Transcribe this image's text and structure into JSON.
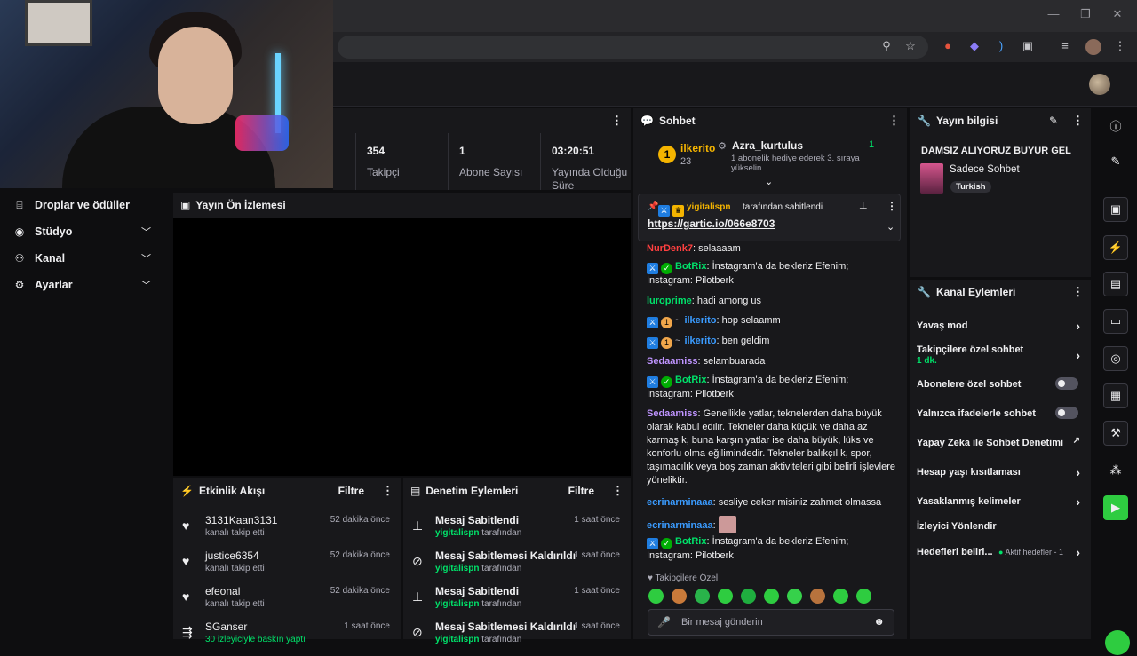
{
  "browser": {
    "window_min": "—",
    "window_max": "❐",
    "window_close": "✕"
  },
  "stats": {
    "followers_value": "354",
    "followers_label": "Takipçi",
    "subs_value": "1",
    "subs_label": "Abone Sayısı",
    "uptime_value": "03:20:51",
    "uptime_label": "Yayında Olduğu Süre"
  },
  "nav": {
    "items": [
      {
        "label": "Droplar ve ödüller",
        "icon": "gift-icon"
      },
      {
        "label": "Stüdyo",
        "icon": "studio-icon"
      },
      {
        "label": "Kanal",
        "icon": "channel-icon"
      },
      {
        "label": "Ayarlar",
        "icon": "gear-icon"
      }
    ]
  },
  "preview": {
    "title": "Yayın Ön İzlemesi"
  },
  "activity": {
    "title": "Etkinlik Akışı",
    "filter": "Filtre",
    "rows": [
      {
        "name": "3131Kaan3131",
        "sub": "kanalı takip etti",
        "time": "52 dakika önce"
      },
      {
        "name": "justice6354",
        "sub": "kanalı takip etti",
        "time": "52 dakika önce"
      },
      {
        "name": "efeonal",
        "sub": "kanalı takip etti",
        "time": "52 dakika önce"
      },
      {
        "name": "SGanser",
        "sub": "30 izleyiciyle baskın yaptı",
        "time": "1 saat önce"
      }
    ]
  },
  "modactions": {
    "title": "Denetim Eylemleri",
    "filter": "Filtre",
    "rows": [
      {
        "name": "Mesaj Sabitlendi",
        "by": "yigitalispn",
        "suffix": " tarafından",
        "time": "1 saat önce"
      },
      {
        "name": "Mesaj Sabitlemesi Kaldırıldı",
        "by": "yigitalispn",
        "suffix": " tarafından",
        "time": "1 saat önce"
      },
      {
        "name": "Mesaj Sabitlendi",
        "by": "yigitalispn",
        "suffix": " tarafından",
        "time": "1 saat önce"
      },
      {
        "name": "Mesaj Sabitlemesi Kaldırıldı",
        "by": "yigitalispn",
        "suffix": " tarafından",
        "time": "1 saat önce"
      }
    ]
  },
  "chat": {
    "title": "Sohbet",
    "leader": {
      "rank": "1",
      "name": "ilkerito",
      "count": "23",
      "gifter": "Azra_kurtulus",
      "gift_count": "1",
      "gift_text": "1 abonelik hediye ederek 3. sıraya yükselin"
    },
    "pinned": {
      "by": "yigitalispn",
      "label": "tarafından sabitlendi",
      "link": "https://gartic.io/066e8703"
    },
    "messages": [
      {
        "user": "NurDenk7",
        "text": ": selaaaam"
      },
      {
        "user": "BotRix",
        "text": ": İnstagram'a da bekleriz Efenim; İnstagram: Pilotberk"
      },
      {
        "user": "luroprime",
        "text": ": hadi among us"
      },
      {
        "user": "ilkerito",
        "text": ": hop selaamm"
      },
      {
        "user": "ilkerito",
        "text": ": ben geldim"
      },
      {
        "user": "Sedaamiss",
        "text": ": selambuarada"
      },
      {
        "user": "BotRix",
        "text": ": İnstagram'a da bekleriz Efenim; İnstagram: Pilotberk"
      },
      {
        "user": "Sedaamiss",
        "text": ": Genellikle yatlar, teknelerden daha büyük olarak kabul edilir. Tekneler daha küçük ve daha az karmaşık, buna karşın yatlar ise daha büyük, lüks ve konforlu olma eğilimindedir. Tekneler balıkçılık, spor, taşımacılık veya boş zaman aktiviteleri gibi belirli işlevlere yöneliktir."
      },
      {
        "user": "ecrinarminaaa",
        "text": ": sesliye ceker misiniz zahmet olmassa"
      },
      {
        "user": "ecrinarminaaa",
        "text": ":"
      },
      {
        "user": "BotRix",
        "text": ": İnstagram'a da bekleriz Efenim; İnstagram: Pilotberk"
      }
    ],
    "followers_only": "Takipçilere Özel",
    "input_placeholder": "Bir mesaj gönderin"
  },
  "info": {
    "title": "Yayın bilgisi",
    "stream_title": "DAMSIZ ALIYORUZ BUYUR GEL",
    "category": "Sadece Sohbet",
    "language": "Turkish"
  },
  "channel_actions": {
    "title": "Kanal Eylemleri",
    "items": [
      {
        "label": "Yavaş mod"
      },
      {
        "label": "Takipçilere özel sohbet",
        "detail": "1 dk."
      },
      {
        "label": "Abonelere özel sohbet"
      },
      {
        "label": "Yalnızca ifadelerle sohbet"
      },
      {
        "label": "Yapay Zeka ile Sohbet Denetimi"
      },
      {
        "label": "Hesap yaşı kısıtlaması"
      },
      {
        "label": "Yasaklanmış kelimeler"
      },
      {
        "label": "İzleyici Yönlendir"
      },
      {
        "label": "Hedefleri belirl...",
        "detail": "Aktif hedefler - 1"
      }
    ]
  },
  "colors": {
    "accent_green": "#00e26a",
    "panel_bg": "#18181b",
    "page_bg": "#0e0e10"
  }
}
